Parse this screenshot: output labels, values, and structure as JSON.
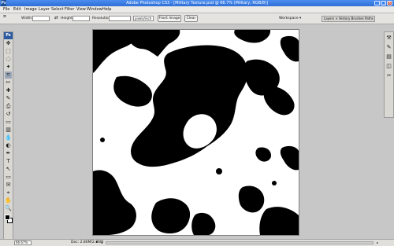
{
  "window": {
    "app_logo": "Ps",
    "title": "Adobe Photoshop CS3 - [Military Texture.psd @ 66.7% (Military, RGB/8)]",
    "minimize": "_",
    "maximize": "□",
    "close": "×"
  },
  "menu": {
    "items": [
      "File",
      "Edit",
      "Image",
      "Layer",
      "Select",
      "Filter",
      "View",
      "Window",
      "Help"
    ]
  },
  "options": {
    "width_label": "Width:",
    "width_value": "",
    "height_label": "Height:",
    "height_value": "",
    "resolution_label": "Resolution:",
    "resolution_value": "",
    "unit_value": "pixels/inch",
    "front_image_label": "Front Image",
    "clear_label": "Clear",
    "workspace_label": "Workspace ▾",
    "palette_tabs": "Layers × History Brushes Paths"
  },
  "toolbox": {
    "header": "Ps",
    "icons": [
      "move-icon",
      "marquee-icon",
      "lasso-icon",
      "magic-wand-icon",
      "crop-icon",
      "slice-icon",
      "healing-icon",
      "brush-icon",
      "clone-stamp-icon",
      "history-brush-icon",
      "eraser-icon",
      "gradient-icon",
      "blur-icon",
      "dodge-icon",
      "pen-icon",
      "type-icon",
      "path-select-icon",
      "shape-icon",
      "notes-icon",
      "eyedropper-icon",
      "hand-icon",
      "zoom-icon"
    ],
    "glyphs": [
      "✥",
      "⬚",
      "◌",
      "✦",
      "⌗",
      "✂",
      "✚",
      "✎",
      "⎙",
      "↺",
      "▭",
      "▥",
      "💧",
      "◐",
      "✒",
      "T",
      "↖",
      "▭",
      "✉",
      "⌖",
      "✋",
      "🔍"
    ],
    "foreground_color": "#000000",
    "background_color": "#ffffff"
  },
  "dock": {
    "icons": [
      "tools-icon",
      "brush-settings-icon",
      "layers-icon",
      "channels-icon",
      "paths-icon"
    ],
    "glyphs": [
      "⚒",
      "✎",
      "▤",
      "◫",
      "✑"
    ]
  },
  "status": {
    "zoom": "66.67%",
    "doc": "Doc: 2.86M/2.86M",
    "arrow": "▸",
    "scroll_left": "◂",
    "scroll_right": "▸"
  },
  "colors": {
    "titlebar": "#2f6fd6",
    "canvas_shape": "#000000",
    "canvas_bg": "#ffffff",
    "workspace": "#c7c7c7"
  }
}
